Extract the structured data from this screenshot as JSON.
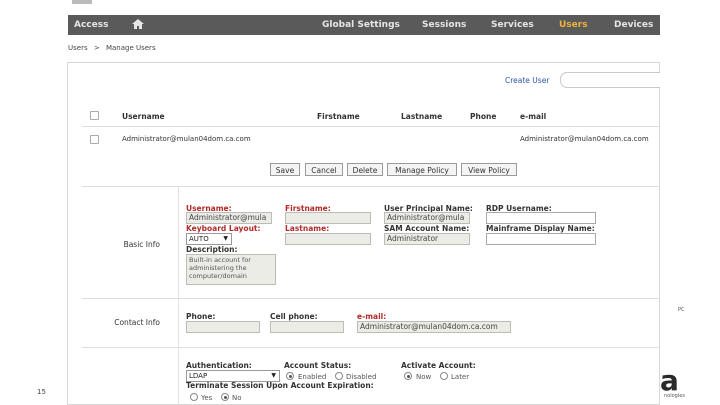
{
  "topbar": {
    "access": "Access",
    "nav": [
      "Global Settings",
      "Sessions",
      "Services",
      "Users",
      "Devices"
    ],
    "active": "Users"
  },
  "breadcrumb": {
    "root": "Users",
    "sep": ">",
    "current": "Manage Users"
  },
  "create_user": "Create User",
  "search": {
    "placeholder": ""
  },
  "table": {
    "headers": {
      "username": "Username",
      "firstname": "Firstname",
      "lastname": "Lastname",
      "phone": "Phone",
      "email": "e-mail"
    },
    "row": {
      "username": "Administrator@mulan04dom.ca.com",
      "email": "Administrator@mulan04dom.ca.com"
    }
  },
  "buttons": [
    "Save",
    "Cancel",
    "Delete",
    "Manage Policy",
    "View Policy"
  ],
  "sections": {
    "basic": "Basic Info",
    "contact": "Contact Info"
  },
  "basic": {
    "username_label": "Username:",
    "username_value": "Administrator@mula",
    "firstname_label": "Firstname:",
    "firstname_value": "",
    "upn_label": "User Principal Name:",
    "upn_value": "Administrator@mula",
    "rdp_label": "RDP Username:",
    "rdp_value": "",
    "keyboard_label": "Keyboard Layout:",
    "keyboard_value": "AUTO",
    "lastname_label": "Lastname:",
    "lastname_value": "",
    "sam_label": "SAM Account Name:",
    "sam_value": "Administrator",
    "mainframe_label": "Mainframe Display Name:",
    "mainframe_value": "",
    "description_label": "Description:",
    "description_value": "Built-in account for\nadministering the\ncomputer/domain"
  },
  "contact": {
    "phone_label": "Phone:",
    "phone_value": "",
    "cell_label": "Cell phone:",
    "cell_value": "",
    "email_label": "e-mail:",
    "email_value": "Administrator@mulan04dom.ca.com"
  },
  "auth": {
    "auth_label": "Authentication:",
    "auth_value": "LDAP",
    "status_label": "Account Status:",
    "status_enabled": "Enabled",
    "status_disabled": "Disabled",
    "activate_label": "Activate Account:",
    "activate_now": "Now",
    "activate_later": "Later",
    "terminate_label": "Terminate Session Upon Account Expiration:",
    "yes": "Yes",
    "no": "No"
  },
  "slide_number": "15",
  "brand": {
    "letter": "a",
    "suffix": "nologies",
    "pc": "PC"
  },
  "colors": {
    "active_nav": "#f0b33c",
    "required_label": "#b22a2a",
    "link": "#2d57a8",
    "topbar": "#5a5a5a"
  }
}
